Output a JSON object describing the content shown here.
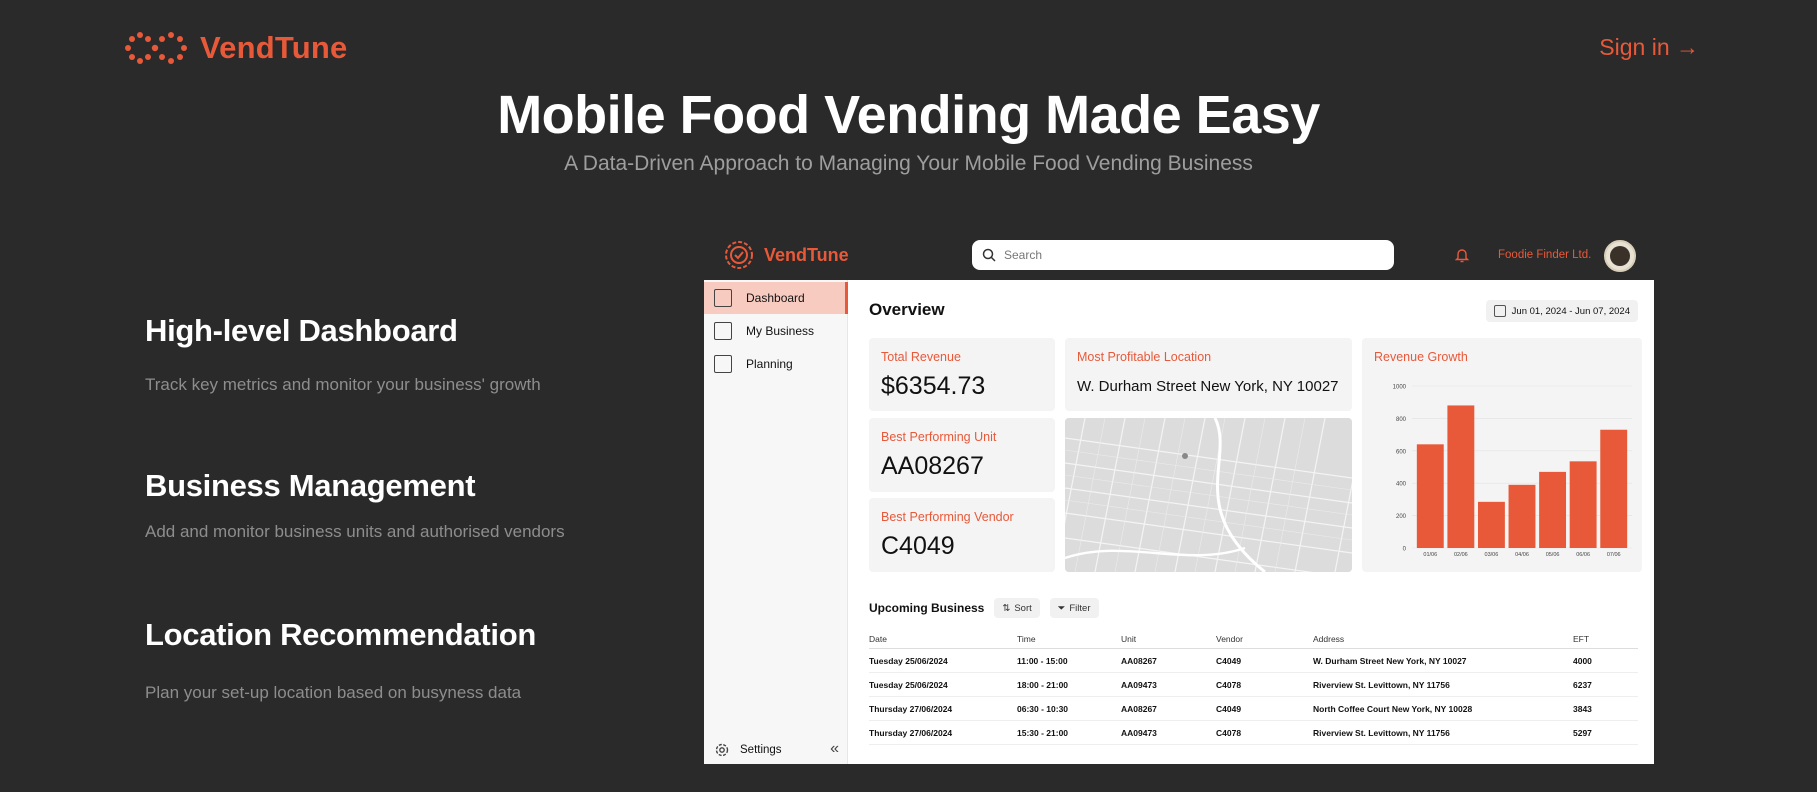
{
  "nav": {
    "brand": "VendTune",
    "signin": "Sign in →"
  },
  "hero": {
    "title": "Mobile Food Vending Made Easy",
    "subtitle": "A Data-Driven Approach to Managing Your Mobile Food Vending Business"
  },
  "features": [
    {
      "title": "High-level Dashboard",
      "desc": "Track key metrics and monitor your business' growth"
    },
    {
      "title": "Business Management",
      "desc": "Add and monitor business units and authorised vendors"
    },
    {
      "title": "Location Recommendation",
      "desc": "Plan your set-up location based on busyness data"
    }
  ],
  "app": {
    "brand": "VendTune",
    "search_placeholder": "Search",
    "org": "Foodie Finder Ltd.",
    "sidebar": [
      "Dashboard",
      "My Business",
      "Planning"
    ],
    "settings": "Settings",
    "overview": "Overview",
    "date_range": "Jun 01, 2024 - Jun 07, 2024",
    "cards": {
      "revenue_label": "Total Revenue",
      "revenue_value": "$6354.73",
      "location_label": "Most Profitable Location",
      "location_value": "W. Durham Street New York, NY 10027",
      "unit_label": "Best Performing Unit",
      "unit_value": "AA08267",
      "vendor_label": "Best Performing Vendor",
      "vendor_value": "C4049",
      "growth_label": "Revenue Growth"
    },
    "upcoming": {
      "title": "Upcoming Business",
      "sort": "Sort",
      "filter": "Filter"
    },
    "table": {
      "headers": [
        "Date",
        "Time",
        "Unit",
        "Vendor",
        "Address",
        "EFT"
      ],
      "rows": [
        [
          "Tuesday 25/06/2024",
          "11:00 - 15:00",
          "AA08267",
          "C4049",
          "W. Durham Street New York, NY 10027",
          "4000"
        ],
        [
          "Tuesday 25/06/2024",
          "18:00 - 21:00",
          "AA09473",
          "C4078",
          "Riverview St. Levittown, NY 11756",
          "6237"
        ],
        [
          "Thursday 27/06/2024",
          "06:30 - 10:30",
          "AA08267",
          "C4049",
          "North Coffee Court New York, NY 10028",
          "3843"
        ],
        [
          "Thursday 27/06/2024",
          "15:30 - 21:00",
          "AA09473",
          "C4078",
          "Riverview St. Levittown, NY 11756",
          "5297"
        ]
      ]
    },
    "colors": {
      "accent": "#e8593a",
      "bar": "#e8593a"
    }
  },
  "chart_data": {
    "type": "bar",
    "title": "Revenue Growth",
    "categories": [
      "01/06",
      "02/06",
      "03/06",
      "04/06",
      "05/06",
      "06/06",
      "07/06"
    ],
    "values": [
      640,
      880,
      285,
      390,
      470,
      535,
      730
    ],
    "yticks": [
      "0",
      "200",
      "400",
      "600",
      "800",
      "1000"
    ],
    "ylim": [
      0,
      1000
    ],
    "grid": true
  }
}
